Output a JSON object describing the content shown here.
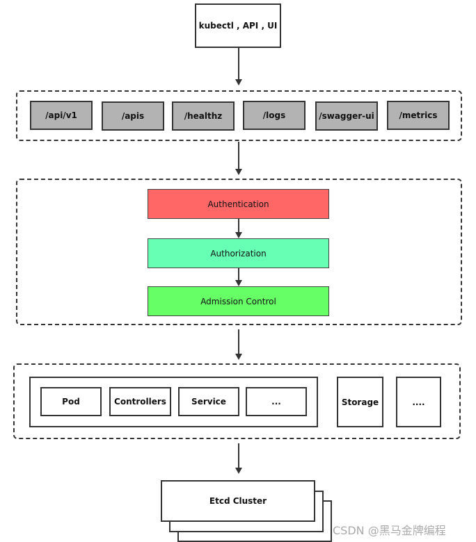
{
  "client": "kubectl , API , UI",
  "endpoints": [
    "/api/v1",
    "/apis",
    "/healthz",
    "/logs",
    "/swagger-ui",
    "/metrics"
  ],
  "pipeline": [
    {
      "label": "Authentication",
      "color": "#ff6666"
    },
    {
      "label": "Authorization",
      "color": "#66ffb3"
    },
    {
      "label": "Admission Control",
      "color": "#66ff66"
    }
  ],
  "resources": [
    "Pod",
    "Controllers",
    "Service",
    "..."
  ],
  "storage": "Storage",
  "more": "....",
  "etcd": "Etcd Cluster",
  "watermark": "CSDN @黑马金牌编程"
}
